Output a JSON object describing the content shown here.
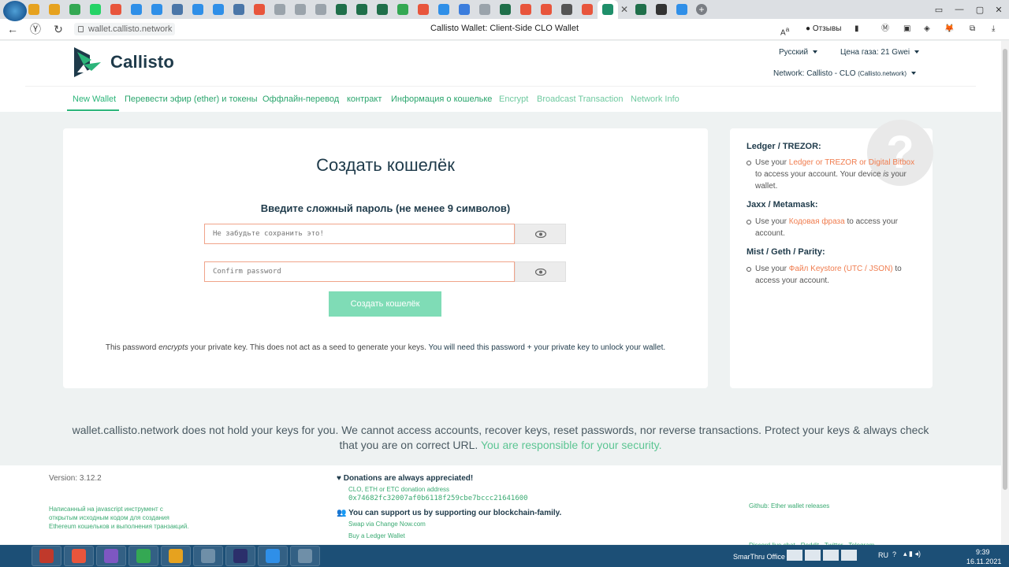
{
  "browser": {
    "url": "wallet.callisto.network",
    "title": "Callisto Wallet: Client-Side CLO Wallet",
    "reviews_label": "Отзывы",
    "tab_colors": [
      "#e6a21f",
      "#e6a21f",
      "#e6a21f",
      "#34a853",
      "#25d366",
      "#e8553c",
      "#2f8fe8",
      "#2f8fe8",
      "#4a76a8",
      "#2f8fe8",
      "#2f8fe8",
      "#4a76a8",
      "#e8553c",
      "#9aa3ab",
      "#9aa3ab",
      "#9aa3ab",
      "#1f6f4a",
      "#1f6f4a",
      "#1f6f4a",
      "#34a853",
      "#e8553c",
      "#2f8fe8",
      "#3b7ddd",
      "#9aa3ab",
      "#1f6f4a",
      "#e8553c",
      "#e8553c",
      "#555555",
      "#e8553c",
      "#1f8f6a",
      "#1f6f4a",
      "#333333",
      "#2f8fe8"
    ]
  },
  "site": {
    "logo_text": "Callisto",
    "language": "Русский",
    "gas_price": "Цена газа: 21 Gwei",
    "network_label": "Network: Callisto - CLO",
    "network_note": "(Callisto.network)",
    "nav": [
      {
        "label": "New Wallet"
      },
      {
        "label": "Перевести эфир (ether) и токены"
      },
      {
        "label": "Оффлайн-перевод"
      },
      {
        "label": "контракт"
      },
      {
        "label": "Информация о кошельке"
      },
      {
        "label": "Encrypt"
      },
      {
        "label": "Broadcast Transaction"
      },
      {
        "label": "Network Info"
      }
    ]
  },
  "main": {
    "title": "Создать кошелёк",
    "password_label": "Введите сложный пароль (не менее 9 символов)",
    "password_placeholder": "Не забудьте сохранить это!",
    "confirm_placeholder": "Confirm password",
    "create_button": "Создать кошелёк",
    "note_part1": "This password ",
    "note_em": "encrypts",
    "note_part2": " your private key. This does not act as a seed to generate your keys. ",
    "note_bold": "You will need this password + your private key to unlock your wallet."
  },
  "side": {
    "help_mark": "?",
    "ledger_heading": "Ledger / TREZOR:",
    "ledger_pre": "Use your ",
    "ledger_link": "Ledger or TREZOR or Digital Bitbox",
    "ledger_mid": " to access your account. Your device ",
    "ledger_em": "is",
    "ledger_post": " your wallet.",
    "jaxx_heading": "Jaxx / Metamask:",
    "jaxx_pre": "Use your ",
    "jaxx_link": "Кодовая фраза",
    "jaxx_post": " to access your account.",
    "mist_heading": "Mist / Geth / Parity:",
    "mist_pre": "Use your ",
    "mist_link": "Файл Keystore (UTC / JSON)",
    "mist_post": " to access your account."
  },
  "disclaimer": {
    "text": "wallet.callisto.network does not hold your keys for you. We cannot access accounts, recover keys, reset passwords, nor reverse transactions. Protect your keys & always check that you are on correct URL. ",
    "highlight": "You are responsible for your security."
  },
  "footer": {
    "version": "Version: 3.12.2",
    "about_line1": "Написанный на javascript инструмент с",
    "about_line2": "открытым исходным кодом для создания",
    "about_line3": "Ethereum кошельков и выполнения транзакций.",
    "donations_heading": "Donations are always appreciated!",
    "donation_sub": "CLO, ETH or ETC donation address",
    "donation_address": "0x74682fc32007af0b6118f259cbe7bccc21641600",
    "support_heading": "You can support us by supporting our blockchain-family.",
    "swap_link": "Swap via Change Now.com",
    "ledger_link": "Buy a Ledger Wallet",
    "github_link": "Github: Ether wallet releases",
    "social_links": "Discord live chat · Reddit · Twitter · Telegram"
  },
  "taskbar": {
    "smarthru": "SmarThru Office",
    "lang": "RU",
    "time": "9:39",
    "date": "16.11.2021",
    "apps": [
      "#c0392b",
      "#e8553c",
      "#7e57c2",
      "#34a853",
      "#e6a21f",
      "#6f8fa8",
      "#2b2f6b",
      "#2f8fe8",
      "#6f8fa8"
    ]
  }
}
